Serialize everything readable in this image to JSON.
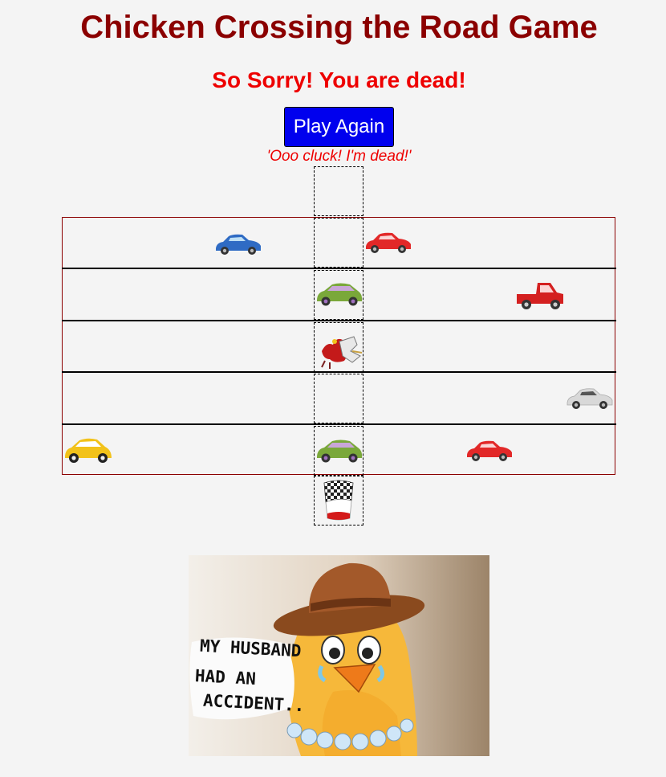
{
  "game": {
    "title": "Chicken Crossing the Road Game",
    "status_message": "So Sorry! You are dead!",
    "play_again_label": "Play Again",
    "chicken_quote": "'Ooo cluck! I'm dead!'"
  },
  "colors": {
    "title": "#8b0000",
    "status": "#ee0000",
    "button_bg": "#0000ee",
    "road_border": "#8b0000",
    "page_bg": "#f4f4f4"
  },
  "road": {
    "lanes": 5,
    "chicken_state": "squashed",
    "chicken_lane": 3,
    "vehicles": [
      {
        "name": "blue-car-icon",
        "lane": 1,
        "type": "sedan",
        "color": "#2f6bc4"
      },
      {
        "name": "red-car-icon",
        "lane": 1,
        "type": "sedan",
        "color": "#e22828"
      },
      {
        "name": "green-hatchback-icon",
        "lane": 2,
        "type": "hatchback",
        "color": "#7aa83a"
      },
      {
        "name": "red-pickup-truck-icon",
        "lane": 2,
        "type": "pickup",
        "color": "#d42020"
      },
      {
        "name": "white-car-icon",
        "lane": 4,
        "type": "sedan",
        "color": "#d8d8d8"
      },
      {
        "name": "yellow-hatchback-icon",
        "lane": 5,
        "type": "hatchback",
        "color": "#f2c21a"
      },
      {
        "name": "green-hatchback-icon",
        "lane": 5,
        "type": "hatchback",
        "color": "#7aa83a"
      },
      {
        "name": "red-car-icon",
        "lane": 5,
        "type": "sedan",
        "color": "#e22828"
      }
    ],
    "finish_icon": "checkered-flag-icon"
  },
  "poster": {
    "icon": "crying-hen-widow-icon",
    "caption_lines": [
      "MY HUSBAND",
      "HAD AN",
      "ACCIDENT.."
    ]
  }
}
